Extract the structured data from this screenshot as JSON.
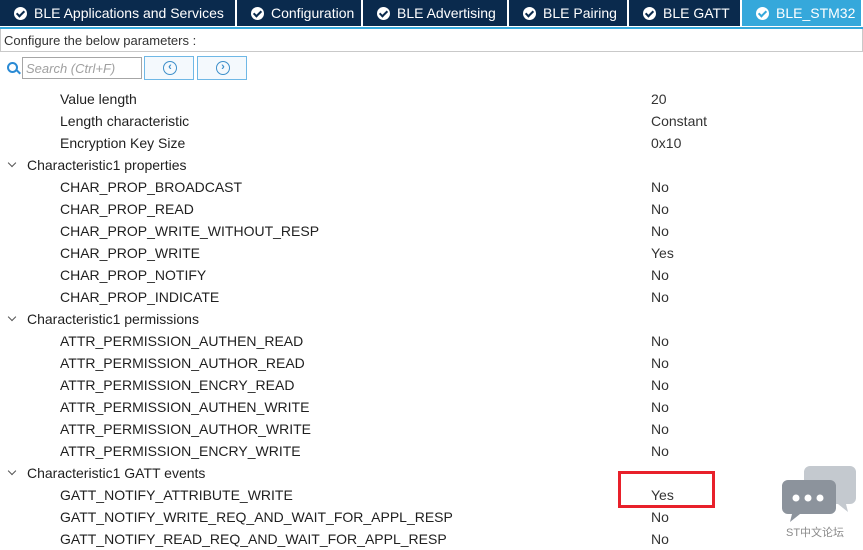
{
  "tabs": [
    {
      "label": "BLE Applications and Services",
      "active": false
    },
    {
      "label": "Configuration",
      "active": false
    },
    {
      "label": "BLE Advertising",
      "active": false
    },
    {
      "label": "BLE Pairing",
      "active": false
    },
    {
      "label": "BLE GATT",
      "active": false
    },
    {
      "label": "BLE_STM32",
      "active": true
    }
  ],
  "config_header": "Configure the below parameters :",
  "search": {
    "placeholder": "Search (Ctrl+F)",
    "value": ""
  },
  "parameters": {
    "value_length": {
      "label": "Value length",
      "value": "20"
    },
    "length_characteristic": {
      "label": "Length characteristic",
      "value": "Constant"
    },
    "encryption_key_size": {
      "label": "Encryption Key Size",
      "value": "0x10"
    },
    "properties": {
      "title": "Characteristic1 properties",
      "items": [
        {
          "label": "CHAR_PROP_BROADCAST",
          "value": "No"
        },
        {
          "label": "CHAR_PROP_READ",
          "value": "No"
        },
        {
          "label": "CHAR_PROP_WRITE_WITHOUT_RESP",
          "value": "No"
        },
        {
          "label": "CHAR_PROP_WRITE",
          "value": "Yes"
        },
        {
          "label": "CHAR_PROP_NOTIFY",
          "value": "No"
        },
        {
          "label": "CHAR_PROP_INDICATE",
          "value": "No"
        }
      ]
    },
    "permissions": {
      "title": "Characteristic1 permissions",
      "items": [
        {
          "label": "ATTR_PERMISSION_AUTHEN_READ",
          "value": "No"
        },
        {
          "label": "ATTR_PERMISSION_AUTHOR_READ",
          "value": "No"
        },
        {
          "label": "ATTR_PERMISSION_ENCRY_READ",
          "value": "No"
        },
        {
          "label": "ATTR_PERMISSION_AUTHEN_WRITE",
          "value": "No"
        },
        {
          "label": "ATTR_PERMISSION_AUTHOR_WRITE",
          "value": "No"
        },
        {
          "label": "ATTR_PERMISSION_ENCRY_WRITE",
          "value": "No"
        }
      ]
    },
    "gatt_events": {
      "title": "Characteristic1 GATT events",
      "items": [
        {
          "label": "GATT_NOTIFY_ATTRIBUTE_WRITE",
          "value": "Yes"
        },
        {
          "label": "GATT_NOTIFY_WRITE_REQ_AND_WAIT_FOR_APPL_RESP",
          "value": "No"
        },
        {
          "label": "GATT_NOTIFY_READ_REQ_AND_WAIT_FOR_APPL_RESP",
          "value": "No"
        }
      ]
    }
  },
  "watermark": {
    "text": "ST中文论坛"
  },
  "colors": {
    "tab_bg": "#0a2a4d",
    "tab_active": "#35a8db",
    "highlight": "#e8202a"
  }
}
